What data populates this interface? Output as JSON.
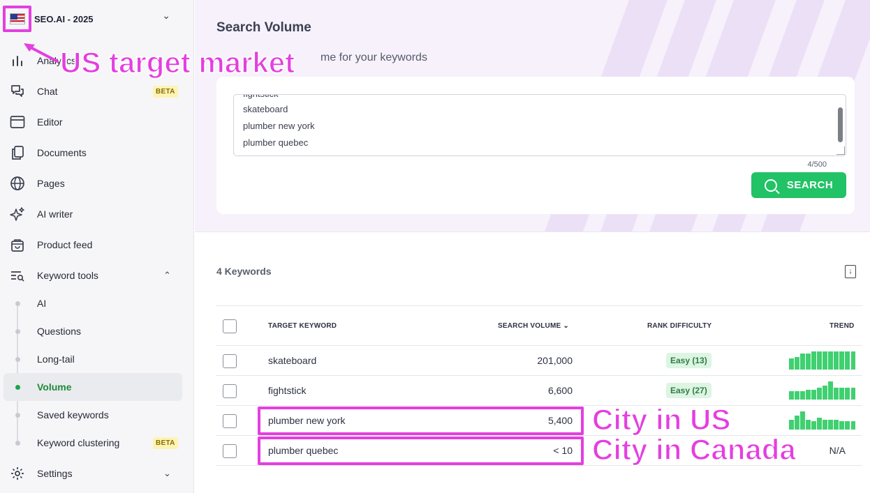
{
  "workspace": {
    "name": "SEO.AI - 2025"
  },
  "sidebar": {
    "items": [
      {
        "label": "Analytics",
        "icon": "bar-chart-icon"
      },
      {
        "label": "Chat",
        "icon": "chat-icon",
        "badge": "BETA"
      },
      {
        "label": "Editor",
        "icon": "editor-icon"
      },
      {
        "label": "Documents",
        "icon": "documents-icon"
      },
      {
        "label": "Pages",
        "icon": "globe-icon"
      },
      {
        "label": "AI writer",
        "icon": "sparkle-icon"
      },
      {
        "label": "Product feed",
        "icon": "bag-icon"
      },
      {
        "label": "Keyword tools",
        "icon": "keyword-search-icon"
      }
    ],
    "keyword_tools_sub": [
      {
        "label": "AI"
      },
      {
        "label": "Questions"
      },
      {
        "label": "Long-tail"
      },
      {
        "label": "Volume"
      },
      {
        "label": "Saved keywords"
      },
      {
        "label": "Keyword clustering",
        "badge": "BETA"
      }
    ],
    "settings_label": "Settings"
  },
  "page": {
    "title": "Search Volume",
    "subtitle_visible": "me for your keywords",
    "textarea_lines": [
      "fightstick",
      "skateboard",
      "plumber new york",
      "plumber quebec"
    ],
    "char_count": "4/500",
    "search_label": "SEARCH",
    "keywords_count": "4 Keywords"
  },
  "table": {
    "headers": {
      "keyword": "TARGET KEYWORD",
      "volume": "SEARCH VOLUME",
      "difficulty": "RANK DIFFICULTY",
      "trend": "TREND"
    },
    "rows": [
      {
        "keyword": "skateboard",
        "volume": "201,000",
        "difficulty": "Easy (13)",
        "trend": [
          6,
          7,
          9,
          9,
          10,
          10,
          10,
          10,
          10,
          10,
          10,
          10
        ]
      },
      {
        "keyword": "fightstick",
        "volume": "6,600",
        "difficulty": "Easy (27)",
        "trend": [
          4,
          4,
          4,
          5,
          5,
          6,
          7,
          9,
          6,
          6,
          6,
          6
        ]
      },
      {
        "keyword": "plumber new york",
        "volume": "5,400",
        "difficulty": "",
        "trend": [
          5,
          7,
          9,
          5,
          4,
          6,
          5,
          5,
          5,
          4,
          4,
          4
        ]
      },
      {
        "keyword": "plumber quebec",
        "volume": "< 10",
        "difficulty": "",
        "trend_text": "N/A"
      }
    ]
  },
  "annotations": {
    "us_market": "US target market",
    "city_us": "City in US",
    "city_canada": "City in Canada",
    "color": "#e43fe0"
  },
  "colors": {
    "accent_green": "#22c266",
    "active_green": "#1f8a3a",
    "badge_yellow": "#fdf3b5"
  }
}
